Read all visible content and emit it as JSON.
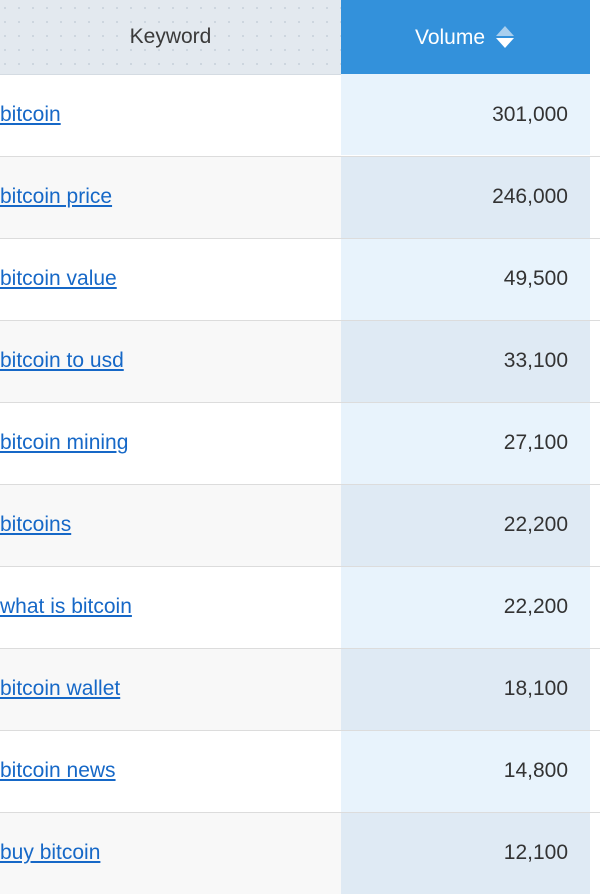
{
  "table": {
    "columns": [
      {
        "key": "keyword",
        "label": "Keyword",
        "align": "center",
        "sortable": true,
        "active": false
      },
      {
        "key": "volume",
        "label": "Volume",
        "align": "right",
        "sortable": true,
        "active": true,
        "sort_direction": "desc"
      }
    ],
    "sort_icon": {
      "up": "sort-ascending-arrow-icon",
      "down": "sort-descending-arrow-icon"
    },
    "rows": [
      {
        "keyword": "bitcoin",
        "volume": "301,000"
      },
      {
        "keyword": "bitcoin price",
        "volume": "246,000"
      },
      {
        "keyword": "bitcoin value",
        "volume": "49,500"
      },
      {
        "keyword": "bitcoin to usd",
        "volume": "33,100"
      },
      {
        "keyword": "bitcoin mining",
        "volume": "27,100"
      },
      {
        "keyword": "bitcoins",
        "volume": "22,200"
      },
      {
        "keyword": "what is bitcoin",
        "volume": "22,200"
      },
      {
        "keyword": "bitcoin wallet",
        "volume": "18,100"
      },
      {
        "keyword": "bitcoin news",
        "volume": "14,800"
      },
      {
        "keyword": "buy bitcoin",
        "volume": "12,100"
      }
    ]
  },
  "colors": {
    "header_keyword_bg": "#e3e9ef",
    "header_volume_bg": "#3391db",
    "header_volume_text": "#ffffff",
    "link": "#1668c7",
    "value_text": "#333333",
    "row_odd_bg": "#ffffff",
    "row_even_bg": "#f8f8f8",
    "volume_odd_bg": "#e8f3fc",
    "volume_even_bg": "#dfeaf4",
    "row_border": "#dcdcdc"
  }
}
